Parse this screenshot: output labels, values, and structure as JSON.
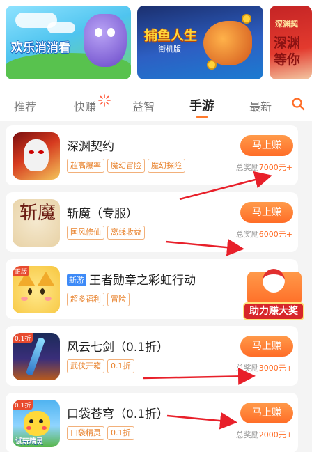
{
  "banners": [
    {
      "title": "欢乐消消看"
    },
    {
      "title": "捕鱼人生",
      "subtitle": "街机版"
    },
    {
      "title_line1": "深渊契",
      "title_line2": "深渊",
      "title_line3": "等你"
    }
  ],
  "tabs": {
    "items": [
      "推荐",
      "快赚",
      "益智",
      "手游",
      "最新"
    ],
    "active": "手游"
  },
  "button_label": "马上赚",
  "reward_prefix": "总奖励",
  "games": [
    {
      "title": "深渊契约",
      "tags": [
        "超高爆率",
        "魔幻冒险",
        "魔幻探险"
      ],
      "reward": "7000元+"
    },
    {
      "title": "斩魔（专服）",
      "icon_text": "斩魔",
      "tags": [
        "国风修仙",
        "离线收益"
      ],
      "reward": "6000元+"
    },
    {
      "badge": "新游",
      "title": "王者勋章之彩虹行动",
      "icon_corner": "正版",
      "tags": [
        "超多福利",
        "冒险"
      ]
    },
    {
      "title": "风云七剑（0.1折）",
      "icon_corner": "0.1折",
      "tags": [
        "武侠开箱",
        "0.1折"
      ],
      "reward": "3000元+"
    },
    {
      "title": "口袋苍穹（0.1折）",
      "icon_corner": "0.1折",
      "icon_text": "试玩精灵",
      "tags": [
        "口袋精灵",
        "0.1折"
      ],
      "reward": "2000元+"
    }
  ],
  "promo": {
    "label": "助力赚大奖"
  },
  "colors": {
    "accent": "#ff6d27",
    "tag": "#e8822c",
    "arrow": "#e8202a",
    "new_badge": "#3d8af7"
  },
  "icons": {
    "search": "search-icon",
    "spark": "sparkle-icon"
  }
}
